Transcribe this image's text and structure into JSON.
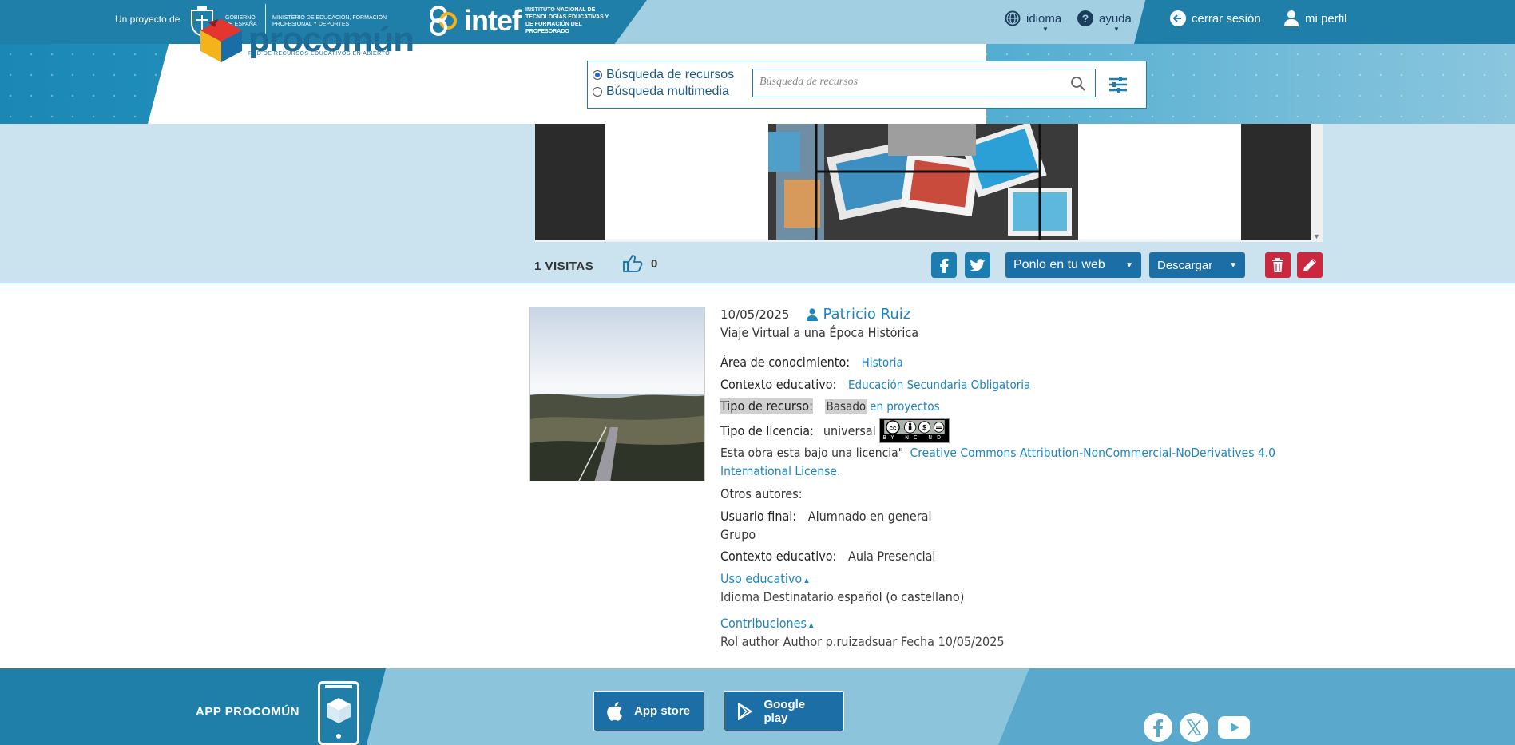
{
  "topbar": {
    "proyecto": "Un proyecto de",
    "gobierno": "GOBIERNO DE ESPAÑA",
    "ministerio": "MINISTERIO DE EDUCACIÓN, FORMACIÓN PROFESIONAL Y DEPORTES",
    "intef_word": "intef",
    "intef_sub": "INSTITUTO NACIONAL DE TECNOLOGÍAS EDUCATIVAS Y DE FORMACIÓN DEL PROFESORADO",
    "idioma": "idioma",
    "ayuda": "ayuda",
    "cerrar": "cerrar sesión",
    "perfil": "mi perfil"
  },
  "header": {
    "logo_word": "procomún",
    "logo_tag": "RED DE RECURSOS EDUCATIVOS EN ABIERTO",
    "radio_recursos": "Búsqueda de recursos",
    "radio_multimedia": "Búsqueda multimedia",
    "search_placeholder": "Búsqueda de recursos"
  },
  "resource": {
    "visits": "1 VISITAS",
    "likes": "0",
    "ponlo": "Ponlo en tu web",
    "descargar": "Descargar"
  },
  "detail": {
    "date": "10/05/2025",
    "author": "Patricio Ruiz",
    "title": "Viaje Virtual a una Época Histórica",
    "area_label": "Área de conocimiento:",
    "area_value": "Historia",
    "contexto_label": "Contexto educativo:",
    "contexto_value": "Educación Secundaria Obligatoria",
    "tipo_label": "Tipo de recurso:",
    "tipo_value_a": "Basado",
    "tipo_value_b": "en proyectos",
    "licencia_label": "Tipo de licencia:",
    "licencia_value": "universal",
    "cc_text": "BY NC ND",
    "obra_prefix": "Esta obra esta bajo una licencia\"",
    "obra_link": "Creative Commons Attribution-NonCommercial-NoDerivatives 4.0",
    "obra_link2": "International License.",
    "otros_label": "Otros autores:",
    "usuario_label": "Usuario final:",
    "usuario_value": "Alumnado en general",
    "grupo": "Grupo",
    "contexto2_label": "Contexto educativo:",
    "contexto2_value": "Aula Presencial",
    "uso_link": "Uso educativo",
    "idioma_label": "Idioma Destinatario",
    "idioma_value": "español (o castellano)",
    "contrib_link": "Contribuciones",
    "rol_line": "Rol author Author p.ruizadsuar Fecha 10/05/2025"
  },
  "footer": {
    "app_label": "APP PROCOMÚN",
    "appstore": "App store",
    "googleplay": "Google play"
  },
  "colors": {
    "brand_dark": "#1f7fa8",
    "link": "#1c86c2",
    "danger": "#c9283e"
  }
}
